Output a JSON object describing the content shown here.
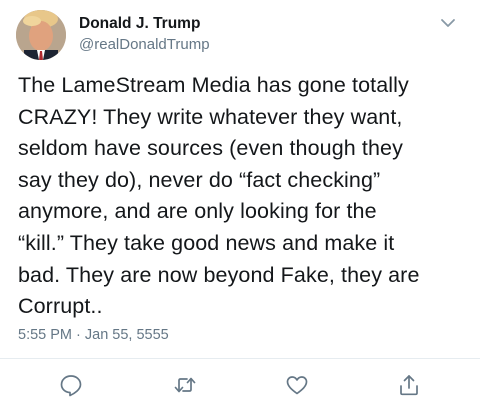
{
  "tweet": {
    "author": {
      "name": "Donald J. Trump",
      "handle": "@realDonaldTrump",
      "avatar_icon": "profile-photo"
    },
    "menu_icon": "chevron-down-icon",
    "text": "The LameStream Media has gone totally\nCRAZY! They write whatever they want,\nseldom have sources (even though they\nsay they do), never do “fact checking”\nanymore, and are only looking for the\n“kill.” They take good news and make it\nbad. They are now beyond Fake, they are\nCorrupt..",
    "timestamp": "5:55 PM · Jan 55, 5555",
    "actions": [
      {
        "name": "reply",
        "icon": "reply-icon"
      },
      {
        "name": "retweet",
        "icon": "retweet-icon"
      },
      {
        "name": "like",
        "icon": "heart-icon"
      },
      {
        "name": "share",
        "icon": "share-icon"
      }
    ],
    "colors": {
      "text": "#14171a",
      "secondary": "#657786",
      "icon": "#657786",
      "divider": "#e6ecf0"
    }
  }
}
